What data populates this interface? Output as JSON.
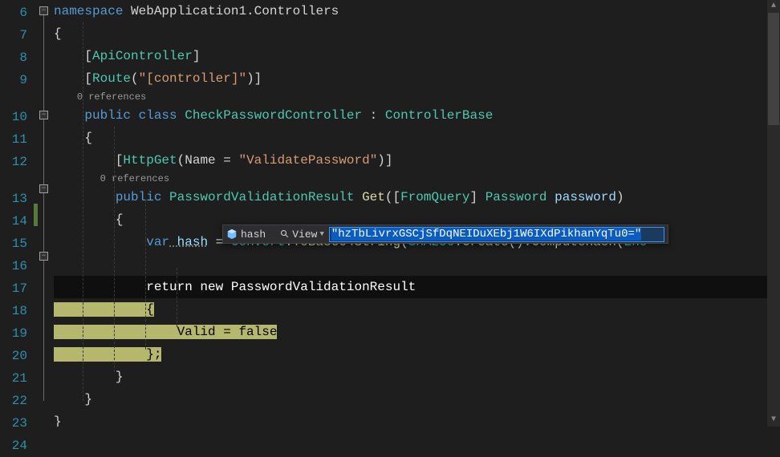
{
  "lines": {
    "l6": "6",
    "l7": "7",
    "l8": "8",
    "l9": "9",
    "l10": "10",
    "l11": "11",
    "l12": "12",
    "l13": "13",
    "l14": "14",
    "l15": "15",
    "l16": "16",
    "l17": "17",
    "l18": "18",
    "l19": "19",
    "l20": "20",
    "l21": "21",
    "l22": "22",
    "l23": "23",
    "l24": "24"
  },
  "codelens": {
    "refs0": "0 references"
  },
  "code": {
    "namespace_kw": "namespace",
    "namespace_name": " WebApplication1.Controllers",
    "brace_open": "{",
    "brace_close": "}",
    "api_controller_open": "[",
    "api_controller": "ApiController",
    "api_controller_close": "]",
    "route_attr": "Route",
    "route_open": "(",
    "route_str": "\"[controller]\"",
    "route_close": ")]",
    "public_kw": "public",
    "class_kw": " class",
    "class_name": " CheckPasswordController",
    "colon": " : ",
    "base_class": "ControllerBase",
    "httpget": "HttpGet",
    "httpget_open": "(",
    "name_prop": "Name",
    "equals": " = ",
    "validate_str": "\"ValidatePassword\"",
    "httpget_close": ")]",
    "return_type": " PasswordValidationResult",
    "get_method": " Get",
    "method_open": "([",
    "from_query": "FromQuery",
    "method_mid": "] ",
    "password_type": "Password",
    "password_param": " password",
    "method_close": ")",
    "var_kw": "var",
    "hash_var": " hash",
    "assign": " = ",
    "convert": "Convert",
    "dot": ".",
    "tobase64": "ToBase64String",
    "sha256": "SHA256",
    "create": "Create",
    "parens": "()",
    "computehash": "ComputeHash",
    "enc": "Enc",
    "return_kw": "return",
    "new_kw": " new",
    "result_type": " PasswordValidationResult",
    "valid_prop": "Valid",
    "false_kw": "false",
    "brace_semi": "};"
  },
  "debug": {
    "var_name": "hash",
    "view_label": "View",
    "value": "\"hzTbLivrxGSCjSfDqNEIDuXEbj1W6IXdPikhanYqTu0=\""
  }
}
